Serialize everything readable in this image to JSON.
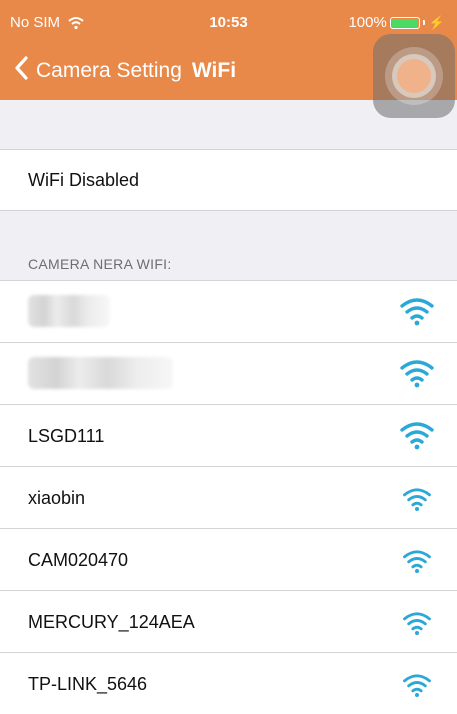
{
  "status_bar": {
    "carrier": "No SIM",
    "time": "10:53",
    "battery": "100%"
  },
  "nav": {
    "back_label": "Camera Setting",
    "title": "WiFi"
  },
  "wifi_status": "WiFi Disabled",
  "section_header": "CAMERA NERA WIFI:",
  "networks": [
    {
      "name": "",
      "blurred": true
    },
    {
      "name": "",
      "blurred": true
    },
    {
      "name": "LSGD111",
      "blurred": false
    },
    {
      "name": "xiaobin",
      "blurred": false
    },
    {
      "name": "CAM020470",
      "blurred": false
    },
    {
      "name": "MERCURY_124AEA",
      "blurred": false
    },
    {
      "name": "TP-LINK_5646",
      "blurred": false
    }
  ],
  "colors": {
    "accent": "#e8894a",
    "wifi_icon": "#2aa8d8",
    "background": "#efeff4"
  },
  "icons": [
    "chevron-left-icon",
    "wifi-signal-icon",
    "battery-icon",
    "assistive-touch-icon"
  ]
}
